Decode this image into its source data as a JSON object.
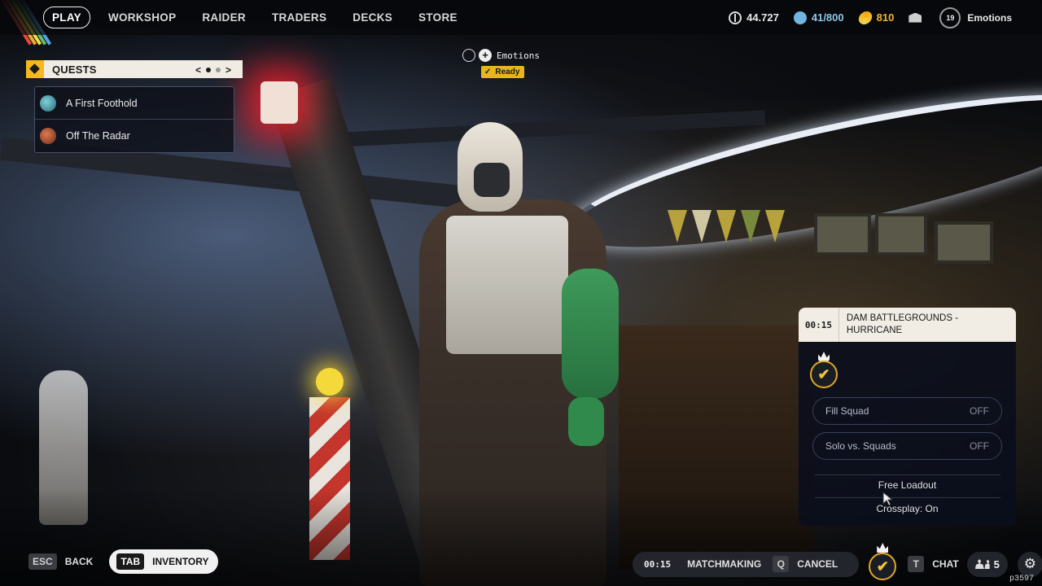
{
  "nav": {
    "items": [
      "PLAY",
      "WORKSHOP",
      "RAIDER",
      "TRADERS",
      "DECKS",
      "STORE"
    ],
    "active_index": 0
  },
  "currencies": {
    "coins": "44.727",
    "blue": "41/800",
    "gold": "810"
  },
  "profile": {
    "level": "19",
    "label": "Emotions"
  },
  "quests": {
    "title": "QUESTS",
    "page_prev": "<",
    "page_next": ">",
    "items": [
      {
        "name": "A First Foothold"
      },
      {
        "name": "Off The Radar"
      }
    ]
  },
  "emotions_status": {
    "label": "Emotions",
    "plus": "+",
    "ready": "Ready"
  },
  "matchmaking_panel": {
    "timer": "00:15",
    "title": "DAM BATTLEGROUNDS - HURRICANE",
    "badge": "✔",
    "fill_squad": {
      "label": "Fill Squad",
      "value": "OFF"
    },
    "solo_vs_squads": {
      "label": "Solo vs. Squads",
      "value": "OFF"
    },
    "loadout": "Free Loadout",
    "crossplay": "Crossplay: On"
  },
  "bottom": {
    "esc_key": "ESC",
    "back": "BACK",
    "tab_key": "TAB",
    "inventory": "INVENTORY",
    "timer": "00:15",
    "matchmaking": "MATCHMAKING",
    "q_key": "Q",
    "cancel": "CANCEL",
    "badge": "✔",
    "t_key": "T",
    "chat": "CHAT",
    "friends_count": "5",
    "settings_icon": "⚙",
    "build": "p3597"
  },
  "colors": {
    "accent_gold": "#f2b81a",
    "blue_currency": "#8fc6e8",
    "panel_light": "#f1ede4",
    "panel_dark": "#0a0e1c"
  }
}
